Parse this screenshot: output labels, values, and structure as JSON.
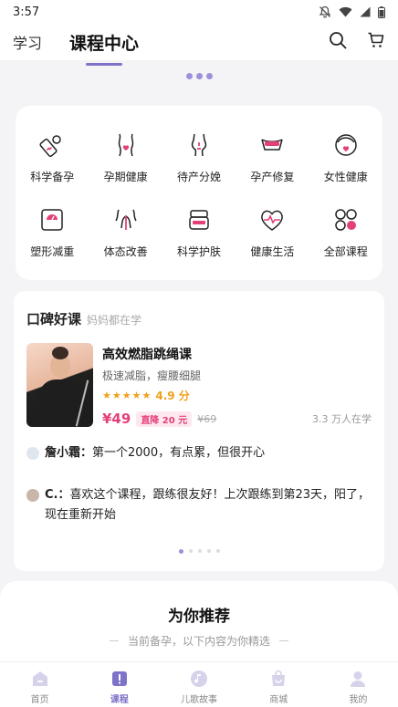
{
  "status_bar": {
    "time": "3:57"
  },
  "top_nav": {
    "tabs": [
      {
        "label": "学习",
        "active": false
      },
      {
        "label": "课程中心",
        "active": true
      }
    ],
    "icons": [
      "search-icon",
      "cart-icon"
    ]
  },
  "categories": [
    {
      "label": "科学备孕",
      "icon": "pregnancy-test-icon"
    },
    {
      "label": "孕期健康",
      "icon": "pregnant-body-icon"
    },
    {
      "label": "待产分娩",
      "icon": "delivery-icon"
    },
    {
      "label": "孕产修复",
      "icon": "postpartum-repair-icon"
    },
    {
      "label": "女性健康",
      "icon": "woman-face-icon"
    },
    {
      "label": "塑形减重",
      "icon": "scale-icon"
    },
    {
      "label": "体态改善",
      "icon": "posture-icon"
    },
    {
      "label": "科学护肤",
      "icon": "skincare-icon"
    },
    {
      "label": "健康生活",
      "icon": "heart-pulse-icon"
    },
    {
      "label": "全部课程",
      "icon": "all-courses-icon"
    }
  ],
  "review_section": {
    "title": "口碑好课",
    "subtitle": "妈妈都在学",
    "course": {
      "name": "高效燃脂跳绳课",
      "desc": "极速减脂，瘦腰细腿",
      "rating": "4.9 分",
      "rating_stars": 5,
      "price": "¥49",
      "drop": "直降 20 元",
      "original_price": "¥69",
      "learners": "3.3 万人在学"
    },
    "comments": [
      {
        "author": "詹小霜：",
        "text": "第一个2000，有点累，但很开心"
      },
      {
        "author": "C.：",
        "text": "喜欢这个课程，跟练很友好！上次跟练到第23天，阳了，现在重新开始"
      }
    ],
    "pager": {
      "count": 5,
      "active": 1
    }
  },
  "recommend": {
    "title": "为你推荐",
    "subtitle": "当前备孕，以下内容为你精选"
  },
  "bottom_nav": [
    {
      "label": "首页",
      "icon": "home-icon",
      "active": false
    },
    {
      "label": "课程",
      "icon": "course-icon",
      "active": true
    },
    {
      "label": "儿歌故事",
      "icon": "music-icon",
      "active": false
    },
    {
      "label": "商城",
      "icon": "shop-bag-icon",
      "active": false
    },
    {
      "label": "我的",
      "icon": "profile-icon",
      "active": false
    }
  ],
  "colors": {
    "accent": "#7d73c8",
    "price": "#e3407a",
    "star": "#f0a11a",
    "icon_pink": "#e3407a"
  }
}
